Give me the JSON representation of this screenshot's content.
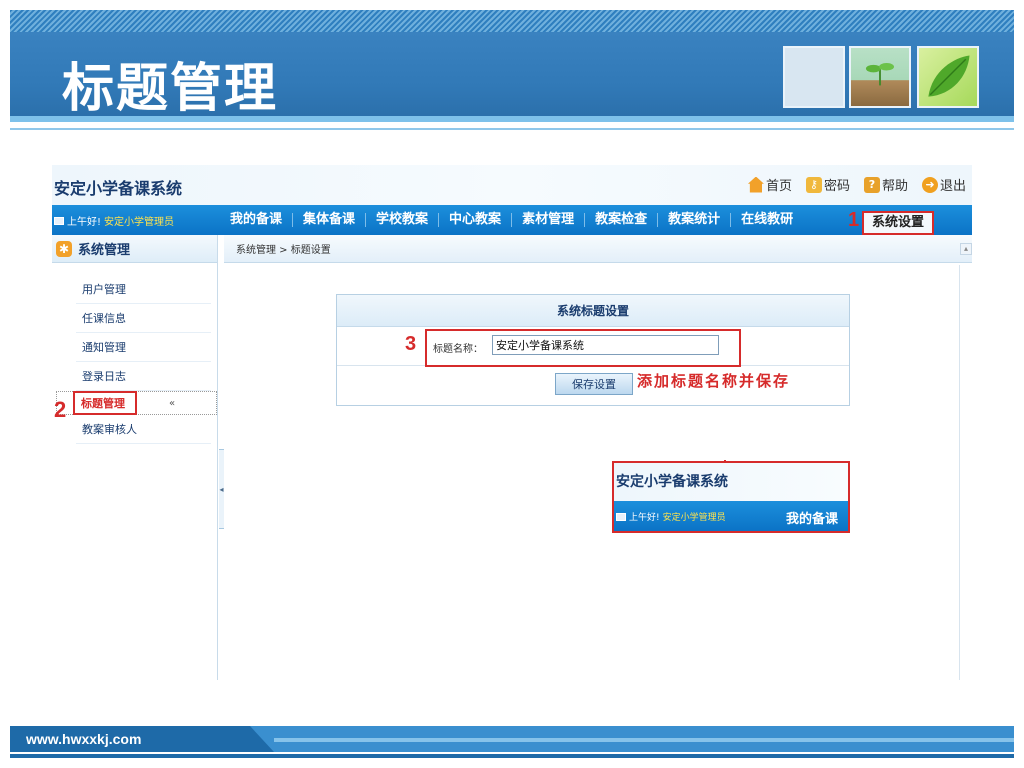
{
  "slide": {
    "title": "标题管理",
    "footer_url": "www.hwxxkj.com"
  },
  "app": {
    "name": "安定小学备课系统",
    "top_links": [
      {
        "icon": "home-icon",
        "label": "首页"
      },
      {
        "icon": "key-icon",
        "label": "密码"
      },
      {
        "icon": "help-icon",
        "label": "帮助"
      },
      {
        "icon": "exit-icon",
        "label": "退出"
      }
    ],
    "greeting_prefix": "上午好!",
    "greeting_user": "安定小学管理员",
    "menu": [
      "我的备课",
      "集体备课",
      "学校教案",
      "中心教案",
      "素材管理",
      "教案检查",
      "教案统计",
      "在线教研"
    ],
    "menu_active": "系统设置"
  },
  "sidebar": {
    "heading": "系统管理",
    "items": [
      "用户管理",
      "任课信息",
      "通知管理",
      "登录日志",
      "标题管理",
      "教案审核人"
    ],
    "active_index": 4,
    "collapse_glyph": "«"
  },
  "content": {
    "breadcrumb": "系统管理 > 标题设置",
    "panel_title": "系统标题设置",
    "field_label": "标题名称：",
    "field_value": "安定小学备课系统",
    "save_button": "保存设置",
    "hint": "添加标题名称并保存"
  },
  "annotations": {
    "step1": "1",
    "step2": "2",
    "step3": "3",
    "color": "#d62b2b"
  },
  "preview": {
    "name": "安定小学备课系统",
    "greeting_prefix": "上午好!",
    "greeting_user": "安定小学管理员",
    "menu_item": "我的备课"
  }
}
